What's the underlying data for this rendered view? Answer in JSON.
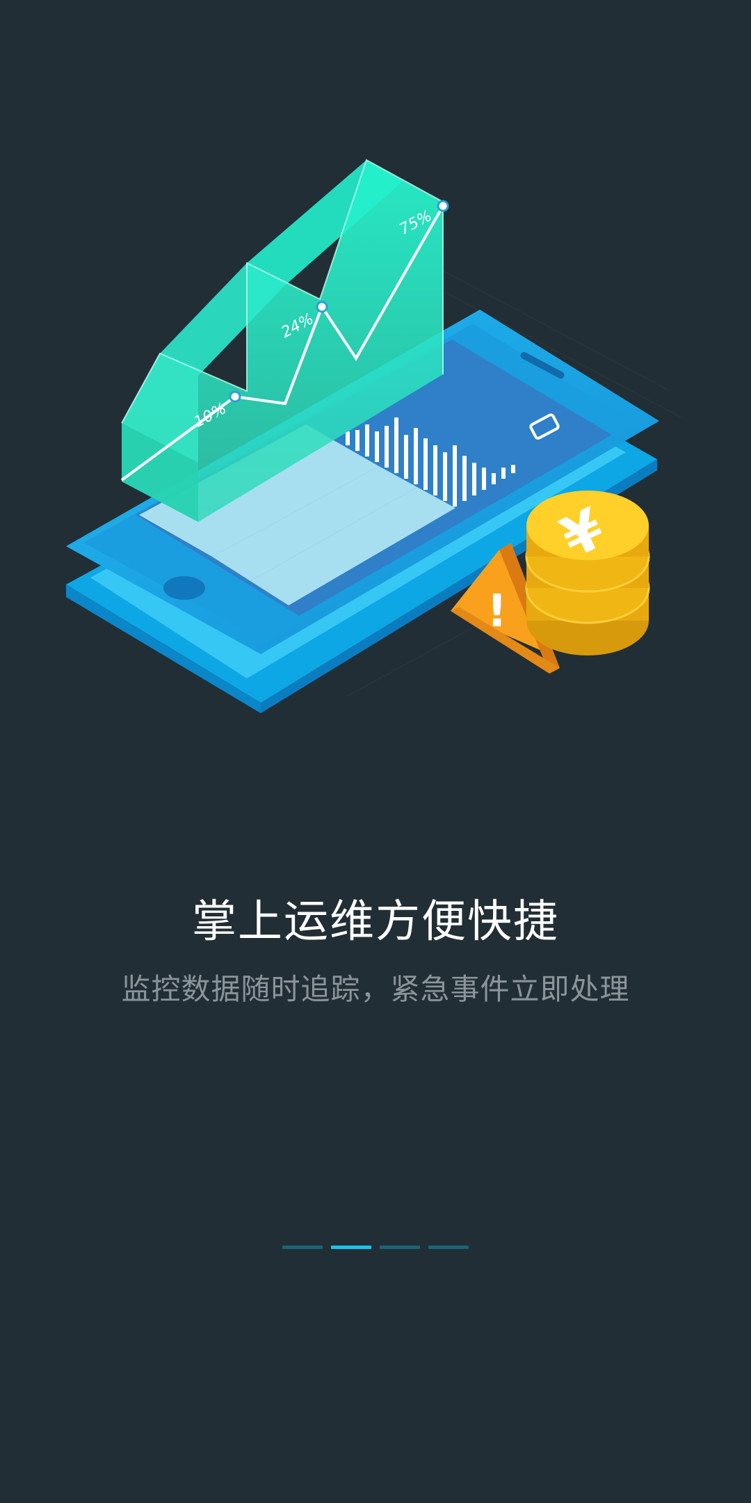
{
  "onboarding": {
    "title": "掌上运维方便快捷",
    "subtitle": "监控数据随时追踪，紧急事件立即处理"
  },
  "illustration": {
    "chart_labels": [
      "10%",
      "24%",
      "75%"
    ],
    "coin_symbol": "¥",
    "warning_symbol": "!"
  },
  "pager": {
    "total": 4,
    "active_index": 1
  },
  "colors": {
    "background": "#222e35",
    "phone": "#1aa7e3",
    "chart": "#2ee8c6",
    "coin": "#f3c21a",
    "warning": "#f5941c",
    "indicator_active": "#19c3ea",
    "indicator_inactive": "#1b6475"
  }
}
